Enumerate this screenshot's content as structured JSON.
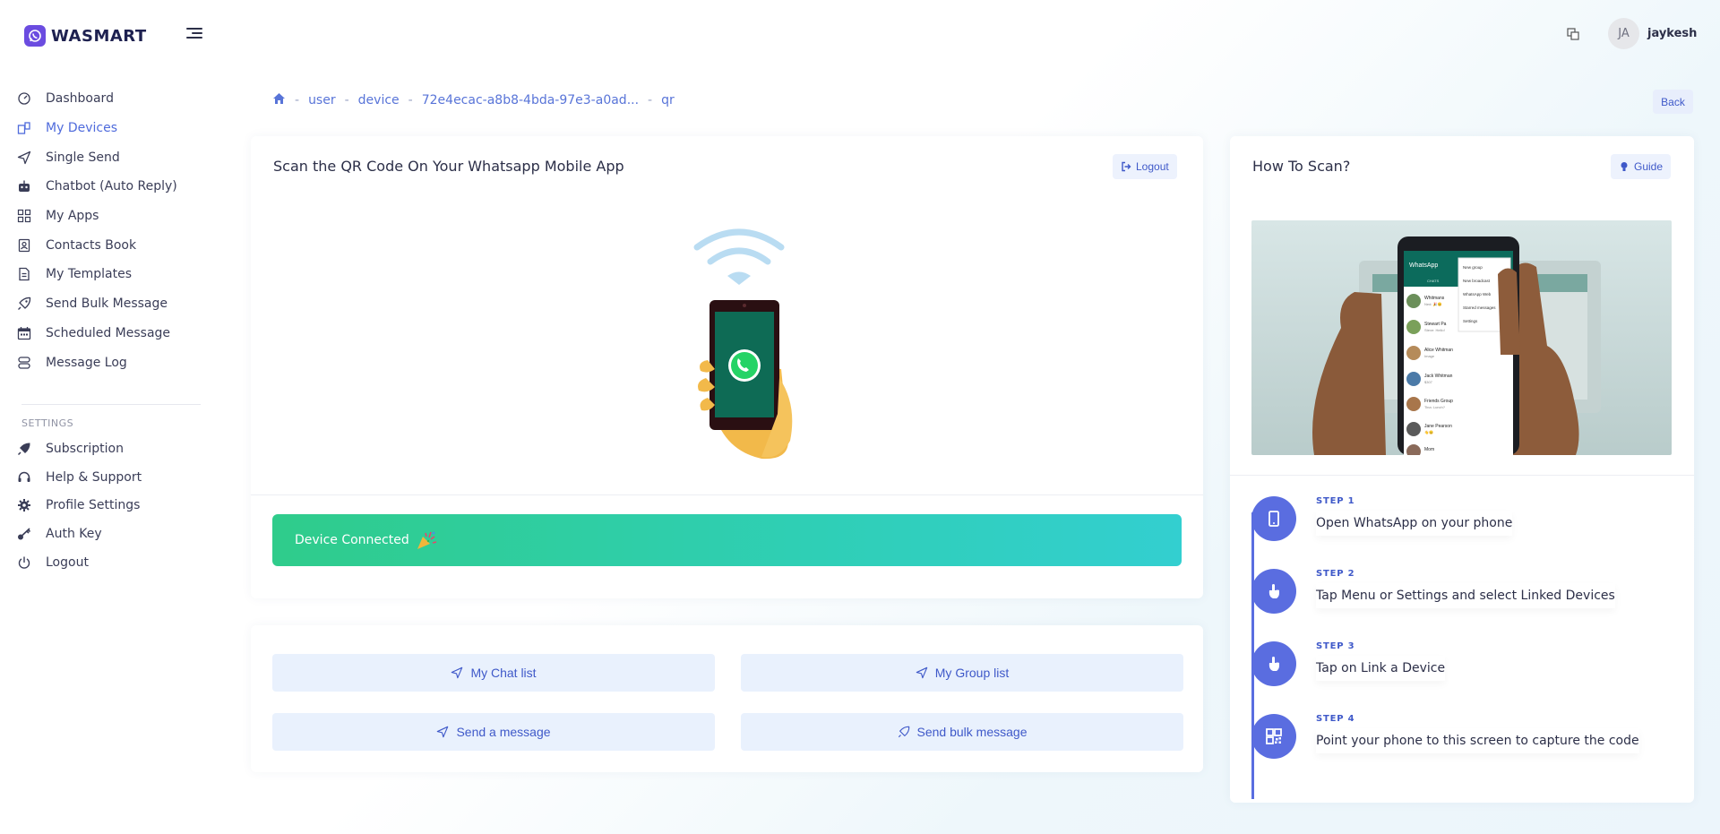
{
  "brand": {
    "name": "WASMART"
  },
  "user": {
    "initials": "JA",
    "name": "jaykesh"
  },
  "sidebar": {
    "items": [
      {
        "label": "Dashboard",
        "icon": "dashboard-icon"
      },
      {
        "label": "My Devices",
        "icon": "devices-icon",
        "active": true
      },
      {
        "label": "Single Send",
        "icon": "send-icon"
      },
      {
        "label": "Chatbot (Auto Reply)",
        "icon": "robot-icon"
      },
      {
        "label": "My Apps",
        "icon": "apps-icon"
      },
      {
        "label": "Contacts Book",
        "icon": "contacts-icon"
      },
      {
        "label": "My Templates",
        "icon": "templates-icon"
      },
      {
        "label": "Send Bulk Message",
        "icon": "rocket-icon"
      },
      {
        "label": "Scheduled Message",
        "icon": "calendar-icon"
      },
      {
        "label": "Message Log",
        "icon": "log-icon"
      }
    ],
    "settings_heading": "SETTINGS",
    "settings_items": [
      {
        "label": "Subscription",
        "icon": "subscription-icon"
      },
      {
        "label": "Help & Support",
        "icon": "headset-icon"
      },
      {
        "label": "Profile Settings",
        "icon": "gear-icon"
      },
      {
        "label": "Auth Key",
        "icon": "key-icon"
      },
      {
        "label": "Logout",
        "icon": "power-icon"
      }
    ]
  },
  "breadcrumb": {
    "items": [
      "user",
      "device",
      "72e4ecac-a8b8-4bda-97e3-a0ad...",
      "qr"
    ]
  },
  "back_label": "Back",
  "qr_card": {
    "title": "Scan the QR Code On Your Whatsapp Mobile App",
    "logout_label": "Logout",
    "status_text": "Device Connected"
  },
  "actions": {
    "chat_list": "My Chat list",
    "group_list": "My Group list",
    "send_message": "Send a message",
    "send_bulk": "Send bulk message"
  },
  "how_card": {
    "title": "How To Scan?",
    "guide_label": "Guide",
    "steps": [
      {
        "num": "STEP 1",
        "text": "Open WhatsApp on your phone"
      },
      {
        "num": "STEP 2",
        "text": "Tap Menu or Settings and select Linked Devices"
      },
      {
        "num": "STEP 3",
        "text": "Tap on Link a Device"
      },
      {
        "num": "STEP 4",
        "text": "Point your phone to this screen to capture the code"
      }
    ],
    "phone_screen": {
      "app_title": "WhatsApp",
      "tab": "CHATS",
      "menu": [
        "New group",
        "New broadcast",
        "WhatsApp Web",
        "Starred messages",
        "Settings"
      ],
      "chats": [
        {
          "name": "Whitmans",
          "preview": "Ned: 🎉😊"
        },
        {
          "name": "Stewart Pa",
          "preview": "Steve: Hello!"
        },
        {
          "name": "Alice Whitman",
          "preview": "Image"
        },
        {
          "name": "Jack Whitman",
          "preview": "$307"
        },
        {
          "name": "Friends Group",
          "preview": "Tina: Lunch?"
        },
        {
          "name": "Jane Pearson",
          "preview": "👋😊"
        },
        {
          "name": "Mom",
          "preview": ""
        }
      ]
    }
  },
  "colors": {
    "accent": "#5a6de0",
    "brand": "#6b4ce0",
    "success_gradient_start": "#2fcc8b",
    "success_gradient_end": "#33cfd0",
    "whatsapp_green": "#25d366"
  }
}
